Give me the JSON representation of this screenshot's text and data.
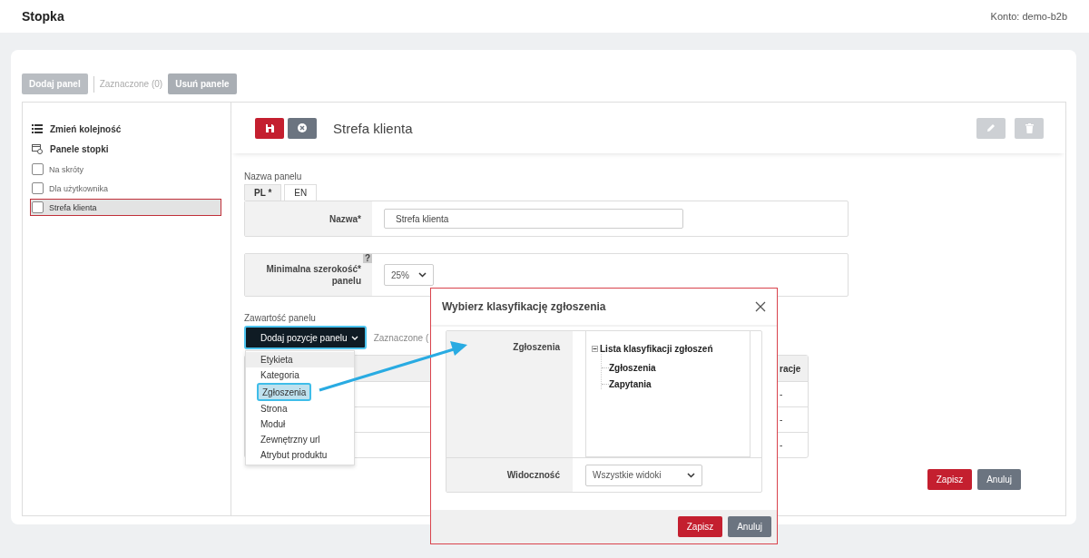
{
  "header": {
    "title": "Stopka",
    "account": "Konto: demo-b2b"
  },
  "toolbar": {
    "add_button": "Dodaj panel",
    "selected_count": "Zaznaczone (0)",
    "delete_button": "Usuń panele"
  },
  "sidebar": {
    "reorder": "Zmień kolejność",
    "section": "Panele stopki",
    "items": [
      {
        "label": "Na skróty",
        "selected": false
      },
      {
        "label": "Dla użytkownika",
        "selected": false
      },
      {
        "label": "Strefa klienta",
        "selected": true
      }
    ]
  },
  "editor": {
    "title": "Strefa klienta",
    "name_caption": "Nazwa panelu",
    "tabs": [
      {
        "label": "PL *",
        "selected": true
      },
      {
        "label": "EN",
        "selected": false
      }
    ],
    "fields": [
      {
        "kind": "text",
        "label_lines": [
          "Nazwa"
        ],
        "mark": "*",
        "value": "Strefa klienta"
      },
      {
        "kind": "select",
        "label_lines": [
          "Minimalna szerokość",
          "panelu"
        ],
        "mark": "*",
        "help": "?",
        "value": "25%"
      }
    ],
    "content": {
      "caption": "Zawartość panelu",
      "add_button": {
        "label": "Dodaj pozycje panelu",
        "highlighted": true
      },
      "selected_count": "Zaznaczone (",
      "table": {
        "columns": [
          "racje"
        ],
        "rows": [
          [
            "-"
          ],
          [
            "-"
          ],
          [
            "-"
          ]
        ]
      }
    },
    "save": "Zapisz",
    "cancel": "Anuluj"
  },
  "menu": {
    "items": [
      {
        "label": "Etykieta",
        "hovered": true,
        "selected": false
      },
      {
        "label": "Kategoria",
        "hovered": false,
        "selected": false
      },
      {
        "label": "Zgłoszenia",
        "hovered": false,
        "selected": true
      },
      {
        "label": "Strona",
        "hovered": false,
        "selected": false
      },
      {
        "label": "Moduł",
        "hovered": false,
        "selected": false
      },
      {
        "label": "Zewnętrzny url",
        "hovered": false,
        "selected": false
      },
      {
        "label": "Atrybut produktu",
        "hovered": false,
        "selected": false
      }
    ]
  },
  "modal": {
    "title": "Wybierz klasyfikację zgłoszenia",
    "fields": [
      {
        "kind": "tree",
        "label": "Zgłoszenia",
        "tree": [
          {
            "label": "Lista klasyfikacji zgłoszeń",
            "expanded": true,
            "children": [
              {
                "label": "Zgłoszenia"
              },
              {
                "label": "Zapytania"
              }
            ]
          }
        ]
      },
      {
        "kind": "select",
        "label": "Widoczność",
        "value": "Wszystkie widoki"
      }
    ],
    "save": "Zapisz",
    "cancel": "Anuluj"
  }
}
